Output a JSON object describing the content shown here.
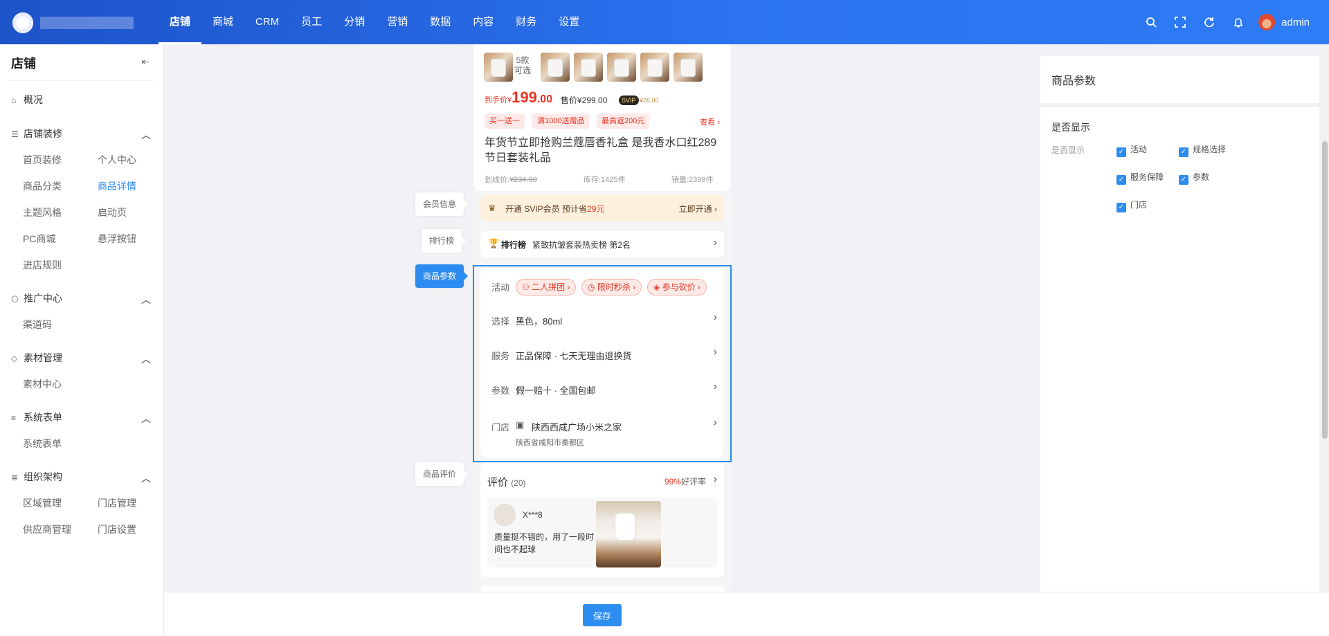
{
  "header": {
    "nav": [
      "店铺",
      "商城",
      "CRM",
      "员工",
      "分销",
      "营销",
      "数据",
      "内容",
      "财务",
      "设置"
    ],
    "active_nav": "店铺",
    "user": "admin"
  },
  "sidebar": {
    "title": "店铺",
    "overview": "概况",
    "groups": {
      "decor": {
        "label": "店铺装修",
        "items": [
          "首页装修",
          "个人中心",
          "商品分类",
          "商品详情",
          "主题风格",
          "启动页",
          "PC商城",
          "悬浮按钮",
          "进店规则"
        ]
      },
      "promo": {
        "label": "推广中心",
        "items": [
          "渠道码"
        ]
      },
      "material": {
        "label": "素材管理",
        "items": [
          "素材中心"
        ]
      },
      "forms": {
        "label": "系统表单",
        "items": [
          "系统表单"
        ]
      },
      "org": {
        "label": "组织架构",
        "items": [
          "区域管理",
          "门店管理",
          "供应商管理",
          "门店设置"
        ]
      }
    },
    "active_item": "商品详情"
  },
  "preview": {
    "gallery_count": "5款\n可选",
    "price_prefix": "到手价¥",
    "price_int": "199",
    "price_dec": ".00",
    "sale_price": "售价¥299.00",
    "svip": "SVIP",
    "svip_price": "¥26.00",
    "tags": [
      "买一送一",
      "满1000送赠品",
      "最高返200元"
    ],
    "tags_more": "查看",
    "title": "年货节立即抢购兰蔻唇香礼盒 是我香水口红289节日套装礼品",
    "strike_label": "划线价:",
    "strike_price": "¥234.00",
    "stock": "库存:1425件",
    "sales": "销量:2399件",
    "member_text": "开通 SVIP会员 预计省",
    "member_save": "29元",
    "member_action": "立即开通",
    "rank_badge": "排行榜",
    "rank_text": "紧致抗皱套装热卖榜 第2名",
    "params": {
      "activity_label": "活动",
      "activities": [
        "二人拼团",
        "限时秒杀",
        "参与砍价"
      ],
      "choose_label": "选择",
      "choose_value": "黑色，80ml",
      "service_label": "服务",
      "service_value": "正品保障 · 七天无理由退换货",
      "param_label": "参数",
      "param_value": "假一赔十 · 全国包邮",
      "store_label": "门店",
      "store_name": "陕西西咸广场小米之家",
      "store_address": "陕西省咸阳市秦都区"
    },
    "review": {
      "title": "评价",
      "count": "(20)",
      "rate": "99%",
      "rate_label": "好评率",
      "user": "X***8",
      "text": "质量挺不错的，用了一段时间也不起球"
    }
  },
  "section_labels": [
    "会员信息",
    "排行榜",
    "商品参数",
    "商品评价"
  ],
  "right_panel": {
    "title": "商品参数",
    "show_title": "是否显示",
    "show_label": "是否显示",
    "options": [
      "活动",
      "规格选择",
      "服务保障",
      "参数",
      "门店"
    ]
  },
  "footer": {
    "save": "保存"
  },
  "colors": {
    "primary": "#2d8cf0",
    "price": "#e93323",
    "header": "#1d53c9"
  }
}
